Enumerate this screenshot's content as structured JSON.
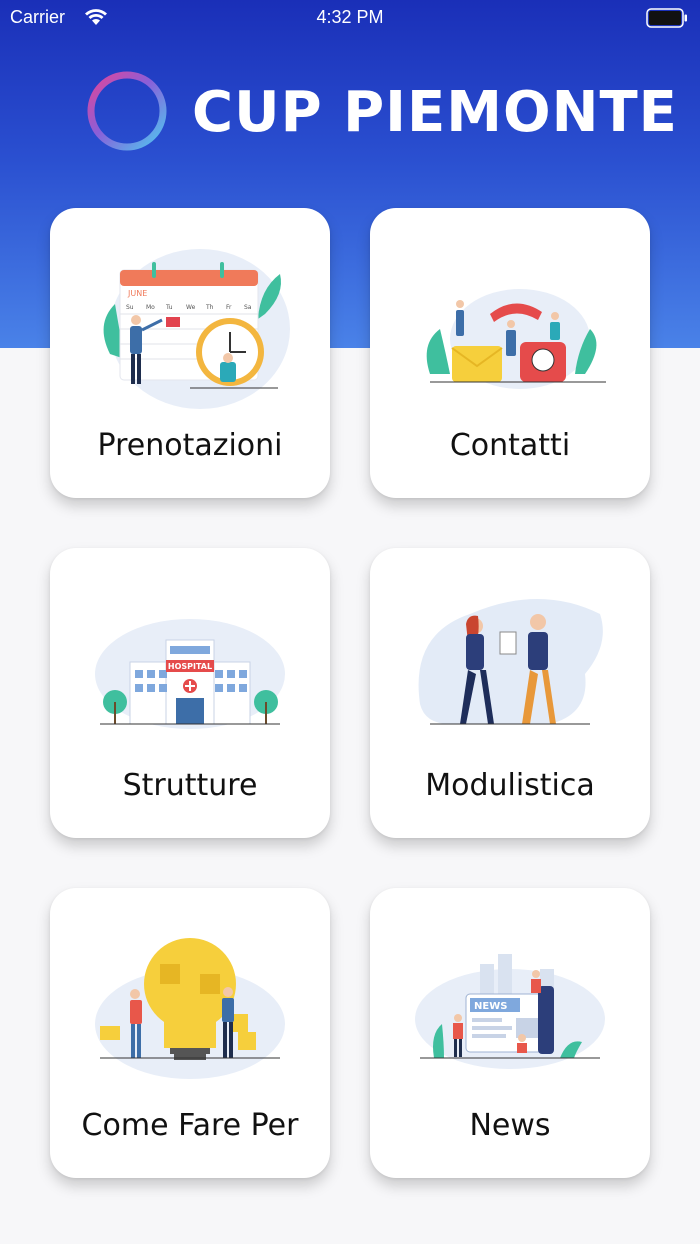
{
  "status_bar": {
    "carrier": "Carrier",
    "time": "4:32 PM"
  },
  "app": {
    "title": "CUP PIEMONTE"
  },
  "menu": [
    {
      "label": "Prenotazioni",
      "icon": "calendar-illustration"
    },
    {
      "label": "Contatti",
      "icon": "phone-contact-illustration"
    },
    {
      "label": "Strutture",
      "icon": "hospital-illustration"
    },
    {
      "label": "Modulistica",
      "icon": "forms-illustration"
    },
    {
      "label": "Come Fare Per",
      "icon": "lightbulb-puzzle-illustration"
    },
    {
      "label": "News",
      "icon": "news-illustration"
    }
  ],
  "illustration_text": {
    "calendar_month": "JUNE",
    "hospital_sign": "HOSPITAL",
    "news_sign": "NEWS",
    "weekdays": [
      "Su",
      "Mo",
      "Tu",
      "We",
      "Th",
      "Fr",
      "Sa"
    ]
  },
  "colors": {
    "header_top": "#1a2fb8",
    "header_bottom": "#4a82e8",
    "background": "#f7f7f9",
    "card": "#ffffff"
  }
}
